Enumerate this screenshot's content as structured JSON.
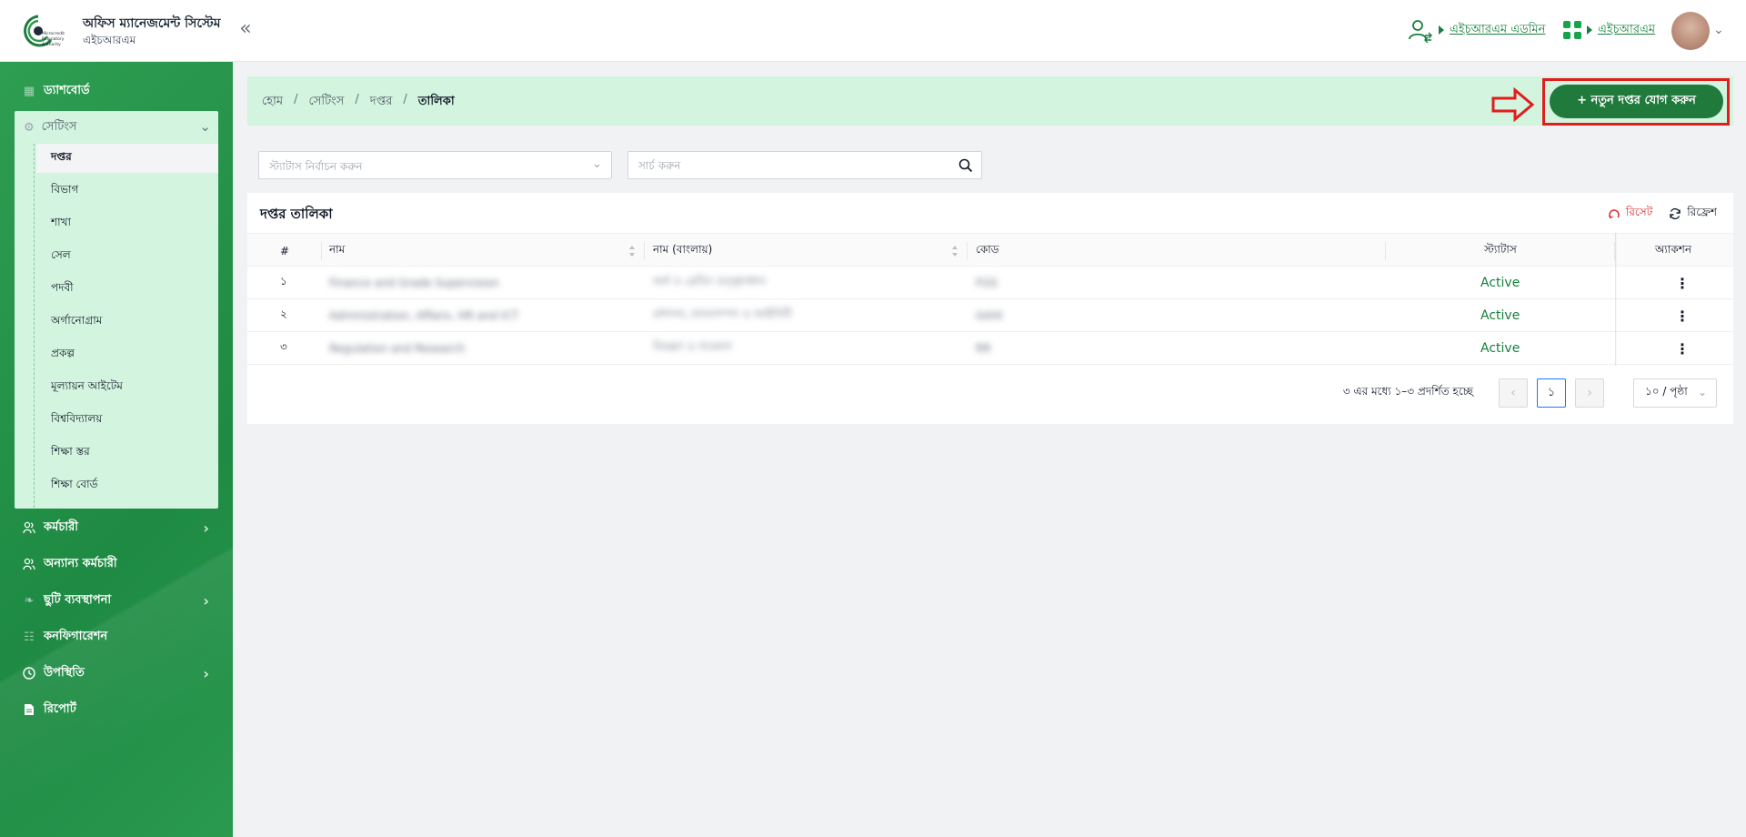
{
  "header": {
    "title": "অফিস ম্যানেজমেন্ট সিস্টেম",
    "subtitle": "এইচআরএম",
    "role_label": "এইচআরএম এডমিন",
    "app_label": "এইচআরএম",
    "logo_lines": [
      "Microcredit",
      "Regulatory",
      "Authority"
    ]
  },
  "sidebar": {
    "items": [
      {
        "label": "ড্যাশবোর্ড"
      },
      {
        "label": "কর্মচারী"
      },
      {
        "label": "অন্যান্য কর্মচারী"
      },
      {
        "label": "ছুটি ব্যবস্থাপনা"
      },
      {
        "label": "কনফিগারেশন"
      },
      {
        "label": "উপস্থিতি"
      },
      {
        "label": "রিপোর্ট"
      }
    ],
    "settings": {
      "label": "সেটিংস",
      "sub_items": [
        {
          "label": "দপ্তর"
        },
        {
          "label": "বিভাগ"
        },
        {
          "label": "শাখা"
        },
        {
          "label": "সেল"
        },
        {
          "label": "পদবী"
        },
        {
          "label": "অর্গানোগ্রাম"
        },
        {
          "label": "প্রকল্প"
        },
        {
          "label": "মূল্যায়ন আইটেম"
        },
        {
          "label": "বিশ্ববিদ্যালয়"
        },
        {
          "label": "শিক্ষা স্তর"
        },
        {
          "label": "শিক্ষা বোর্ড"
        }
      ]
    }
  },
  "breadcrumb": {
    "items": [
      "হোম",
      "সেটিংস",
      "দপ্তর"
    ],
    "current": "তালিকা"
  },
  "add_button": "+ নতুন দপ্তর যোগ করুন",
  "filters": {
    "status_placeholder": "স্ট্যাটাস নির্বাচন করুন",
    "search_placeholder": "সার্চ করুন"
  },
  "table": {
    "title": "দপ্তর তালিকা",
    "reset_label": "রিসেট",
    "refresh_label": "রিফ্রেশ",
    "columns": {
      "index": "#",
      "name": "নাম",
      "name_bn": "নাম (বাংলায়)",
      "code": "কোড",
      "status": "স্ট্যাটাস",
      "action": "অ্যাকশন"
    },
    "rows": [
      {
        "index": "১",
        "name": "Finance and Grade Supervision",
        "name_bn": "অর্থ ও গ্রেডিং তত্ত্বাবধান",
        "code": "FGS",
        "status": "Active"
      },
      {
        "index": "২",
        "name": "Administration, Affairs, HR and ICT",
        "name_bn": "প্রশাসন, মানবসম্পদ ও আইসিটি",
        "code": "AAHI",
        "status": "Active"
      },
      {
        "index": "৩",
        "name": "Regulation and Research",
        "name_bn": "নিয়ন্ত্রণ ও গবেষণা",
        "code": "RR",
        "status": "Active"
      }
    ]
  },
  "pagination": {
    "summary": "৩ এর মধ্যে ১–৩ প্রদর্শিত হচ্ছে",
    "current_page": "১",
    "page_size": "১০ / পৃষ্ঠা"
  },
  "colors": {
    "sidebar": "#229348",
    "accent": "#1f7a3c",
    "breadcrumb_bg": "#d3f4df",
    "status_active": "#15803d",
    "highlight": "#e11d1d"
  }
}
